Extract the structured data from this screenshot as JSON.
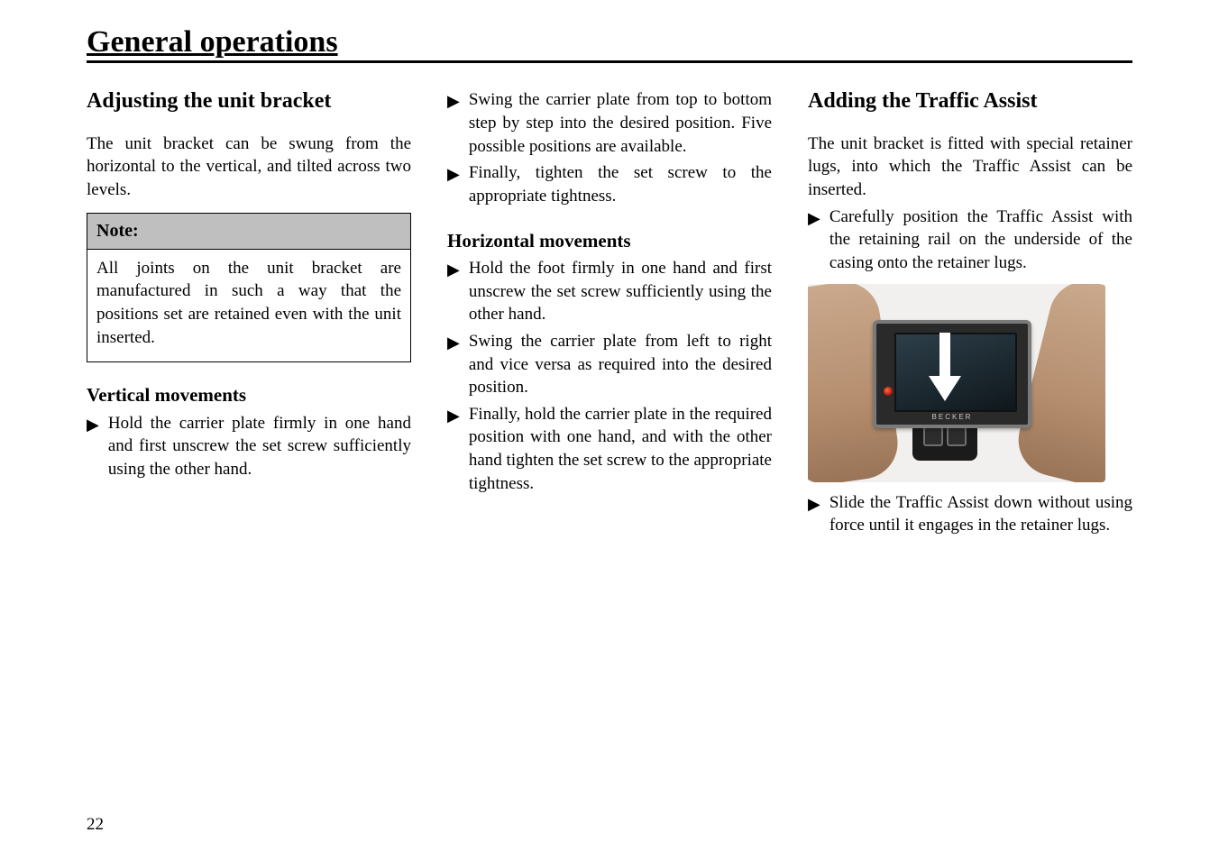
{
  "page": {
    "title": "General operations",
    "number": "22"
  },
  "col1": {
    "heading": "Adjusting the unit bracket",
    "intro": "The unit bracket can be swung from the horizontal to the vertical, and tilted across two levels.",
    "note": {
      "label": "Note:",
      "body": "All joints on the unit bracket are manufactured in such a way that the positions set are retained even with the unit inserted."
    },
    "vertical": {
      "heading": "Vertical movements",
      "b1": "Hold the carrier plate firmly in one hand and first unscrew the set screw sufficiently using the other hand."
    }
  },
  "col2": {
    "b1": "Swing the carrier plate from top to bottom step by step into the desired position. Five possible positions are available.",
    "b2": "Finally, tighten the set screw to the appropriate tightness.",
    "horizontal": {
      "heading": "Horizontal movements",
      "b1": "Hold the foot firmly in one hand and first unscrew the set screw sufficiently using the other hand.",
      "b2": "Swing the carrier plate from left to right and vice versa as required into the desired position.",
      "b3": "Finally, hold the carrier plate in the required position with one hand, and with the other hand tighten the set screw to the appropriate tightness."
    }
  },
  "col3": {
    "heading": "Adding the Traffic Assist",
    "intro": "The unit bracket is fitted with special retainer lugs, into which the Traffic Assist can be inserted.",
    "b1": "Carefully position the Traffic Assist with the retaining rail on the underside of the casing onto the retainer lugs.",
    "device_label": "BECKER",
    "b2": "Slide the Traffic Assist down without using force until it engages in the retainer lugs."
  }
}
